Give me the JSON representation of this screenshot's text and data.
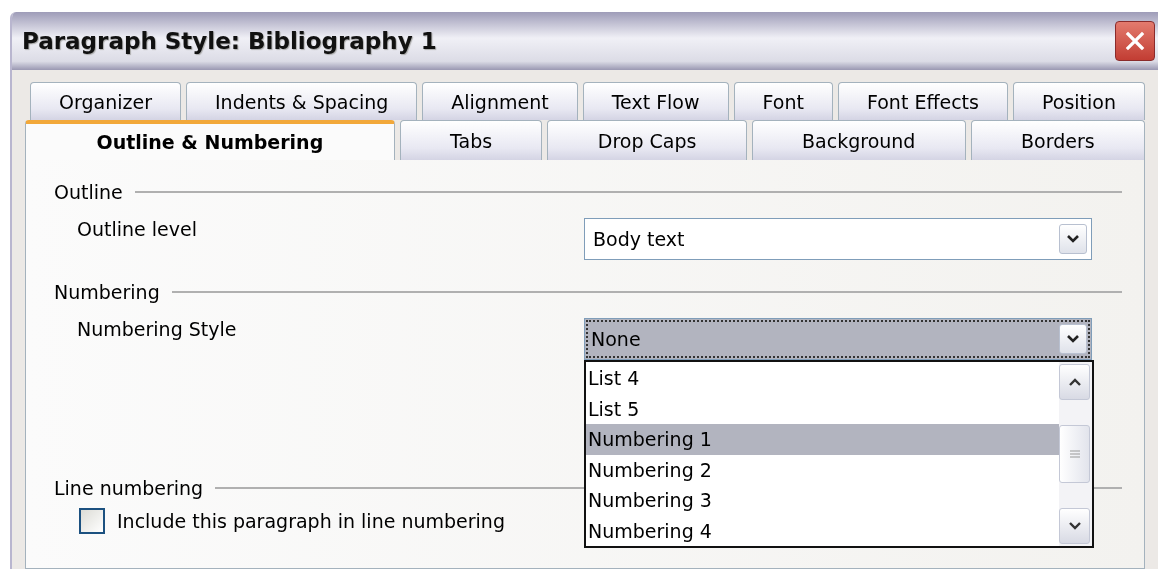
{
  "window": {
    "title": "Paragraph Style: Bibliography 1"
  },
  "tab_rows": [
    {
      "tabs": [
        {
          "label": "Organizer",
          "selected": false
        },
        {
          "label": "Indents & Spacing",
          "selected": false
        },
        {
          "label": "Alignment",
          "selected": false
        },
        {
          "label": "Text Flow",
          "selected": false
        },
        {
          "label": "Font",
          "selected": false
        },
        {
          "label": "Font Effects",
          "selected": false
        },
        {
          "label": "Position",
          "selected": false
        }
      ]
    },
    {
      "tabs": [
        {
          "label": "Outline & Numbering",
          "selected": true
        },
        {
          "label": "Tabs",
          "selected": false
        },
        {
          "label": "Drop Caps",
          "selected": false
        },
        {
          "label": "Background",
          "selected": false
        },
        {
          "label": "Borders",
          "selected": false
        }
      ]
    }
  ],
  "outline": {
    "heading": "Outline",
    "outline_level": {
      "label": "Outline level",
      "value": "Body text"
    }
  },
  "numbering": {
    "heading": "Numbering",
    "numbering_style": {
      "label": "Numbering Style",
      "value": "None",
      "expanded": true,
      "options": [
        {
          "label": "List 4",
          "selected": false
        },
        {
          "label": "List 5",
          "selected": false
        },
        {
          "label": "Numbering 1",
          "selected": true
        },
        {
          "label": "Numbering 2",
          "selected": false
        },
        {
          "label": "Numbering 3",
          "selected": false
        },
        {
          "label": "Numbering 4",
          "selected": false
        }
      ]
    }
  },
  "line_numbering": {
    "heading": "Line numbering",
    "include": {
      "label": "Include this paragraph in line numbering",
      "checked": false
    }
  }
}
